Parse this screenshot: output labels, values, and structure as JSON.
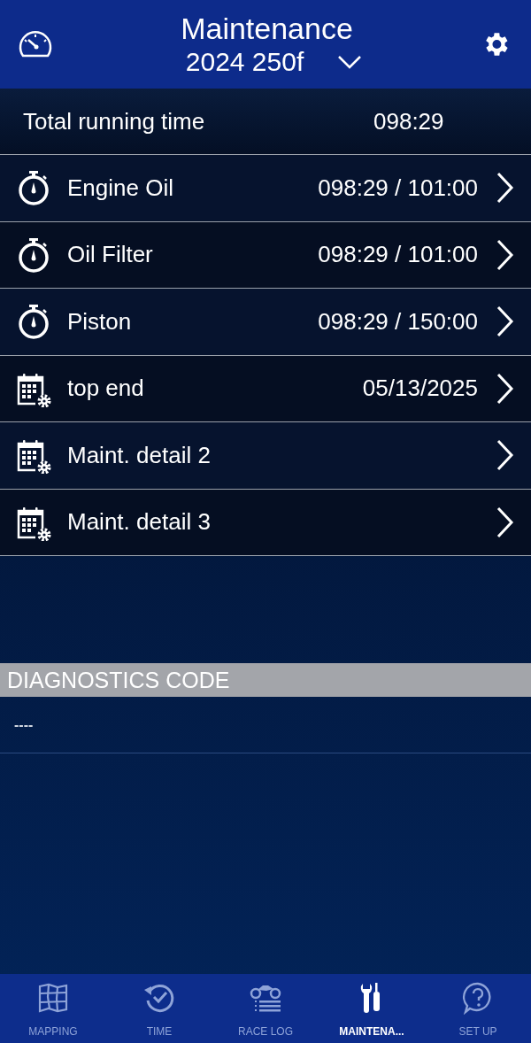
{
  "header": {
    "title": "Maintenance",
    "model": "2024 250f"
  },
  "total": {
    "label": "Total running time",
    "value": "098:29"
  },
  "items": [
    {
      "kind": "timer",
      "label": "Engine Oil",
      "value": "098:29 / 101:00"
    },
    {
      "kind": "timer",
      "label": "Oil Filter",
      "value": "098:29 / 101:00"
    },
    {
      "kind": "timer",
      "label": "Piston",
      "value": "098:29 / 150:00"
    },
    {
      "kind": "calendar",
      "label": "top end",
      "value": "05/13/2025"
    },
    {
      "kind": "calendar",
      "label": "Maint. detail 2"
    },
    {
      "kind": "calendar",
      "label": "Maint. detail 3"
    }
  ],
  "diagnostics": {
    "heading": "DIAGNOSTICS CODE",
    "code": "----"
  },
  "tabs": [
    {
      "kind": "map",
      "label": "MAPPING",
      "selected": false
    },
    {
      "kind": "time",
      "label": "TIME",
      "selected": false
    },
    {
      "kind": "racelog",
      "label": "RACE LOG",
      "selected": false
    },
    {
      "kind": "tools",
      "label": "MAINTENA...",
      "selected": true
    },
    {
      "kind": "help",
      "label": "SET UP",
      "selected": false
    }
  ]
}
